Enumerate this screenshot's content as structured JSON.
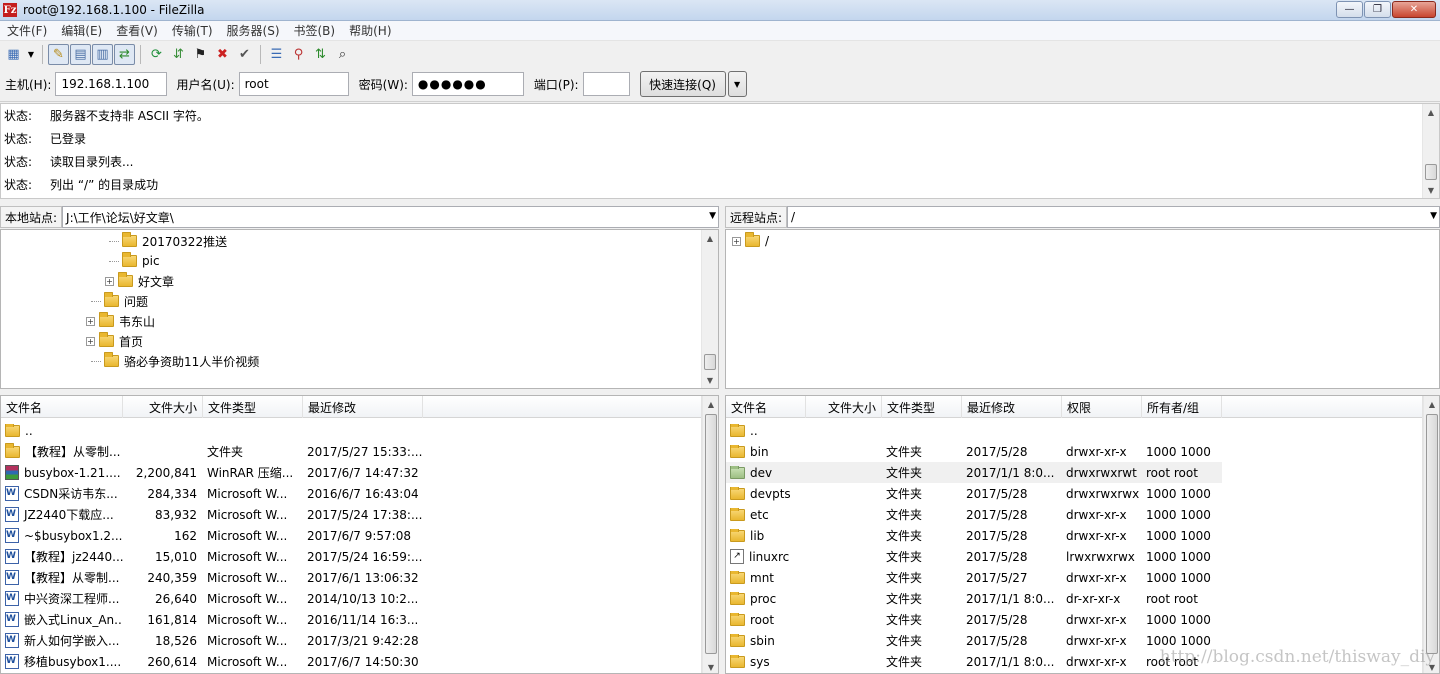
{
  "window": {
    "title": "root@192.168.1.100 - FileZilla",
    "icon_letter": "Fz"
  },
  "menu": [
    "文件(F)",
    "编辑(E)",
    "查看(V)",
    "传输(T)",
    "服务器(S)",
    "书签(B)",
    "帮助(H)"
  ],
  "quickconnect": {
    "host_label": "主机(H):",
    "host_value": "192.168.1.100",
    "user_label": "用户名(U):",
    "user_value": "root",
    "pass_label": "密码(W):",
    "pass_value": "●●●●●●",
    "port_label": "端口(P):",
    "port_value": "",
    "button_label": "快速连接(Q)"
  },
  "log": [
    {
      "key": "状态:",
      "msg": "服务器不支持非 ASCII 字符。"
    },
    {
      "key": "状态:",
      "msg": "已登录"
    },
    {
      "key": "状态:",
      "msg": "读取目录列表..."
    },
    {
      "key": "状态:",
      "msg": "列出 “/” 的目录成功"
    }
  ],
  "local": {
    "site_label": "本地站点:",
    "path": "J:\\工作\\论坛\\好文章\\",
    "tree": [
      "20170322推送",
      "pic",
      "好文章",
      "问题",
      "韦东山",
      "首页",
      "骆必争资助11人半价视频"
    ],
    "columns": [
      "文件名",
      "文件大小",
      "文件类型",
      "最近修改"
    ],
    "rows": [
      {
        "name": "..",
        "size": "",
        "type": "",
        "modified": "",
        "icon": "folder"
      },
      {
        "name": "【教程】从零制...",
        "size": "",
        "type": "文件夹",
        "modified": "2017/5/27 15:33:...",
        "icon": "folder"
      },
      {
        "name": "busybox-1.21....",
        "size": "2,200,841",
        "type": "WinRAR 压缩...",
        "modified": "2017/6/7 14:47:32",
        "icon": "rar"
      },
      {
        "name": "CSDN采访韦东...",
        "size": "284,334",
        "type": "Microsoft W...",
        "modified": "2016/6/7 16:43:04",
        "icon": "doc"
      },
      {
        "name": "JZ2440下载应...",
        "size": "83,932",
        "type": "Microsoft W...",
        "modified": "2017/5/24 17:38:...",
        "icon": "doc"
      },
      {
        "name": "~$busybox1.2...",
        "size": "162",
        "type": "Microsoft W...",
        "modified": "2017/6/7 9:57:08",
        "icon": "doc"
      },
      {
        "name": "【教程】jz2440...",
        "size": "15,010",
        "type": "Microsoft W...",
        "modified": "2017/5/24 16:59:...",
        "icon": "doc"
      },
      {
        "name": "【教程】从零制...",
        "size": "240,359",
        "type": "Microsoft W...",
        "modified": "2017/6/1 13:06:32",
        "icon": "doc"
      },
      {
        "name": "中兴资深工程师...",
        "size": "26,640",
        "type": "Microsoft W...",
        "modified": "2014/10/13 10:2...",
        "icon": "doc"
      },
      {
        "name": "嵌入式Linux_An...",
        "size": "161,814",
        "type": "Microsoft W...",
        "modified": "2016/11/14 16:3...",
        "icon": "doc"
      },
      {
        "name": "新人如何学嵌入...",
        "size": "18,526",
        "type": "Microsoft W...",
        "modified": "2017/3/21 9:42:28",
        "icon": "doc"
      },
      {
        "name": "移植busybox1....",
        "size": "260,614",
        "type": "Microsoft W...",
        "modified": "2017/6/7 14:50:30",
        "icon": "doc"
      }
    ]
  },
  "remote": {
    "site_label": "远程站点:",
    "path": "/",
    "tree_root": "/",
    "columns": [
      "文件名",
      "文件大小",
      "文件类型",
      "最近修改",
      "权限",
      "所有者/组"
    ],
    "rows": [
      {
        "name": "..",
        "type": "",
        "modified": "",
        "perm": "",
        "owner": "",
        "icon": "folder"
      },
      {
        "name": "bin",
        "type": "文件夹",
        "modified": "2017/5/28",
        "perm": "drwxr-xr-x",
        "owner": "1000 1000",
        "icon": "folder"
      },
      {
        "name": "dev",
        "type": "文件夹",
        "modified": "2017/1/1 8:0...",
        "perm": "drwxrwxrwt",
        "owner": "root root",
        "icon": "green"
      },
      {
        "name": "devpts",
        "type": "文件夹",
        "modified": "2017/5/28",
        "perm": "drwxrwxrwx",
        "owner": "1000 1000",
        "icon": "folder"
      },
      {
        "name": "etc",
        "type": "文件夹",
        "modified": "2017/5/28",
        "perm": "drwxr-xr-x",
        "owner": "1000 1000",
        "icon": "folder"
      },
      {
        "name": "lib",
        "type": "文件夹",
        "modified": "2017/5/28",
        "perm": "drwxr-xr-x",
        "owner": "1000 1000",
        "icon": "folder"
      },
      {
        "name": "linuxrc",
        "type": "文件夹",
        "modified": "2017/5/28",
        "perm": "lrwxrwxrwx",
        "owner": "1000 1000",
        "icon": "link"
      },
      {
        "name": "mnt",
        "type": "文件夹",
        "modified": "2017/5/27",
        "perm": "drwxr-xr-x",
        "owner": "1000 1000",
        "icon": "folder"
      },
      {
        "name": "proc",
        "type": "文件夹",
        "modified": "2017/1/1 8:0...",
        "perm": "dr-xr-xr-x",
        "owner": "root root",
        "icon": "folder"
      },
      {
        "name": "root",
        "type": "文件夹",
        "modified": "2017/5/28",
        "perm": "drwxr-xr-x",
        "owner": "1000 1000",
        "icon": "folder"
      },
      {
        "name": "sbin",
        "type": "文件夹",
        "modified": "2017/5/28",
        "perm": "drwxr-xr-x",
        "owner": "1000 1000",
        "icon": "folder"
      },
      {
        "name": "sys",
        "type": "文件夹",
        "modified": "2017/1/1 8:0...",
        "perm": "drwxr-xr-x",
        "owner": "root root",
        "icon": "folder"
      }
    ]
  },
  "watermark": "http://blog.csdn.net/thisway_diy"
}
